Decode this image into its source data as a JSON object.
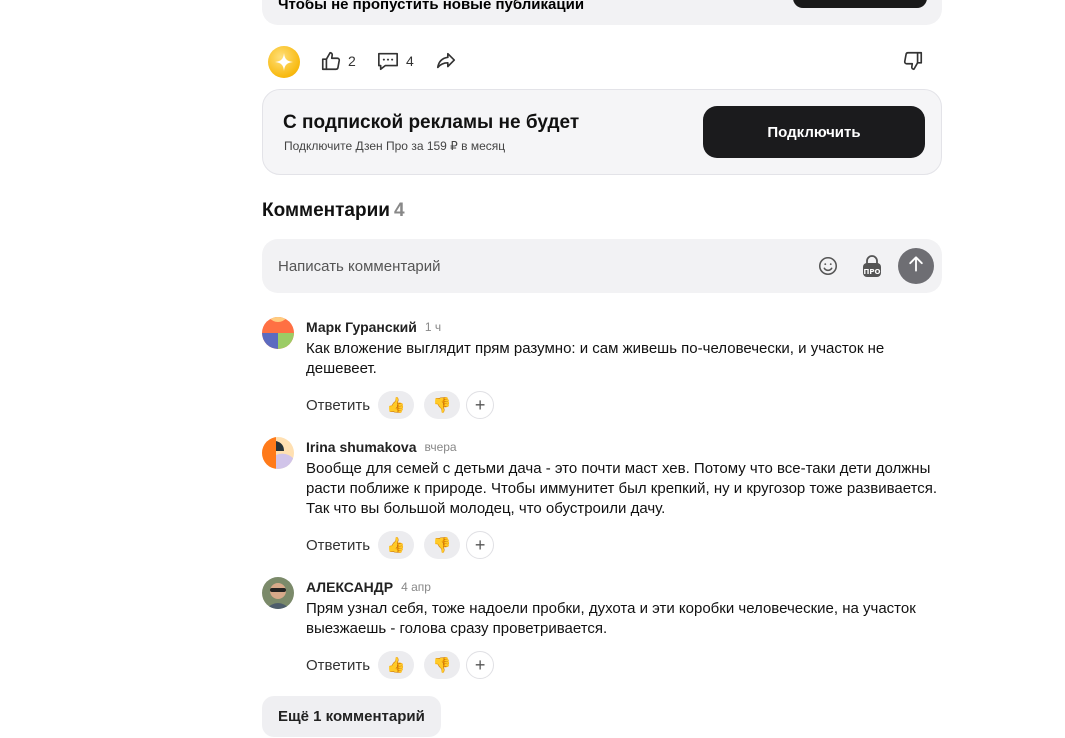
{
  "top_banner": {
    "text": "Чтобы не пропустить новые публикации"
  },
  "actions": {
    "like_count": "2",
    "comments_count": "4"
  },
  "noads": {
    "title": "С подпиской рекламы не будет",
    "subtitle": "Подключите Дзен Про за 159 ₽ в месяц",
    "button": "Подключить"
  },
  "comments_header": {
    "label": "Комментарии",
    "count": "4"
  },
  "comment_input": {
    "placeholder": "Написать комментарий"
  },
  "comments": [
    {
      "author": "Марк Гуранский",
      "time": "1 ч",
      "text": "Как вложение выглядит прям разумно: и сам живешь по-человечески, и участок не дешевеет.",
      "reply": "Ответить"
    },
    {
      "author": "Irina shumakova",
      "time": "вчера",
      "text": "Вообще для семей с детьми дача - это почти маст хев. Потому что все-таки дети должны расти поближе к природе. Чтобы иммунитет был крепкий, ну и кругозор тоже развивается. Так что вы большой молодец, что обустроили дачу.",
      "reply": "Ответить"
    },
    {
      "author": "АЛЕКСАНДР",
      "time": "4 апр",
      "text": "Прям узнал себя, тоже надоели пробки, духота и эти коробки человеческие, на участок выезжаешь - голова сразу проветривается.",
      "reply": "Ответить"
    }
  ],
  "reactions": {
    "thumbs_up": "👍",
    "thumbs_down": "👎",
    "add": "+"
  },
  "more_comments": "Ещё 1 комментарий",
  "colors": {
    "dark_button": "#1b1b1d",
    "zen_star": "#f8b90f",
    "banner_bg": "#f5f5f7"
  }
}
